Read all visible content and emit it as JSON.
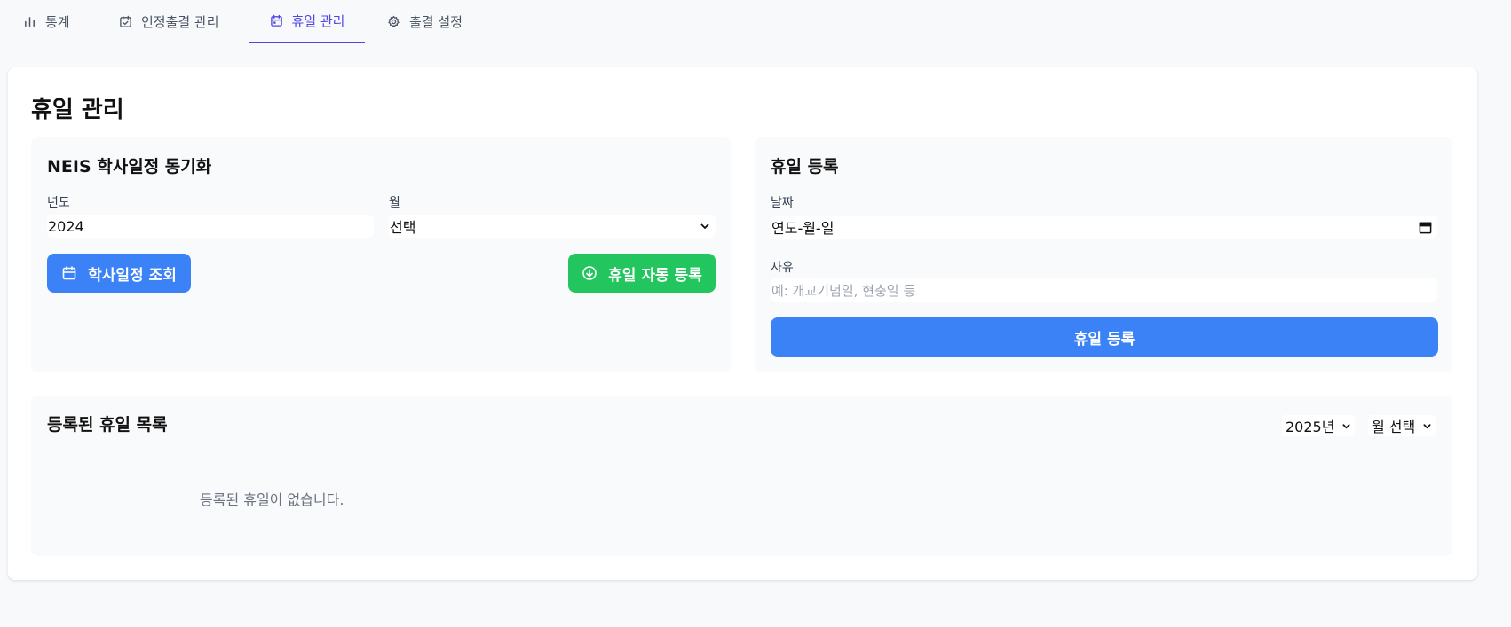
{
  "tabs": {
    "stats": "통계",
    "auth": "인정출결 관리",
    "holiday": "휴일 관리",
    "settings": "출결 설정"
  },
  "page": {
    "title": "휴일 관리"
  },
  "neis": {
    "title": "NEIS 학사일정 동기화",
    "year_label": "년도",
    "year_value": "2024",
    "month_label": "월",
    "month_value": "선택",
    "lookup_button": "학사일정 조회",
    "auto_register_button": "휴일 자동 등록"
  },
  "register": {
    "title": "휴일 등록",
    "date_label": "날짜",
    "date_placeholder": "연도-월-일",
    "reason_label": "사유",
    "reason_placeholder": "예: 개교기념일, 현충일 등",
    "submit_button": "휴일 등록"
  },
  "list": {
    "title": "등록된 휴일 목록",
    "year_select": "2025년",
    "month_select": "월 선택",
    "empty_message": "등록된 휴일이 없습니다."
  },
  "colors": {
    "accent": "#4f46e5",
    "primary_button": "#3b82f6",
    "success_button": "#22c55e"
  }
}
